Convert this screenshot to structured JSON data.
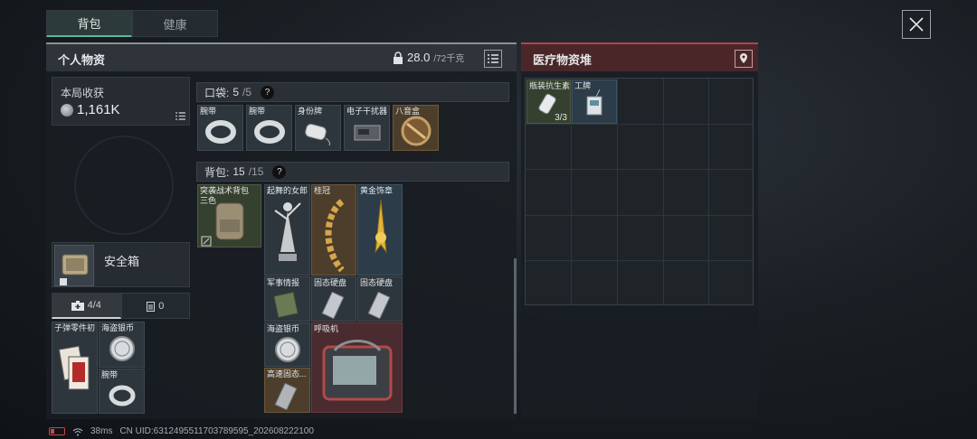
{
  "tabs": [
    {
      "label": "背包",
      "active": true
    },
    {
      "label": "健康",
      "active": false
    }
  ],
  "left_panel": {
    "title": "个人物资",
    "weight_current": "28.0",
    "weight_max": "/72千克"
  },
  "right_panel": {
    "title": "医疗物资堆"
  },
  "earnings": {
    "label": "本局收获",
    "value": "1,161K"
  },
  "safe": {
    "label": "安全箱"
  },
  "sub_tabs": [
    {
      "label": "4/4",
      "icon": "medkit-icon"
    },
    {
      "label": "0",
      "icon": "clipboard-icon"
    }
  ],
  "pocket": {
    "label": "口袋:",
    "count": "5",
    "capacity": "/5",
    "items": [
      "腕带",
      "腕带",
      "身份牌",
      "电子干扰器",
      "八音盒"
    ]
  },
  "backpack": {
    "label": "背包:",
    "count": "15",
    "capacity": "/15",
    "equipped": "突袭战术背包三色",
    "items": [
      "起舞的女郎",
      "桂冠",
      "黄金饰章",
      "军事情报",
      "固态硬盘",
      "固态硬盘",
      "海盗银币",
      "呼吸机",
      "高速固态..."
    ]
  },
  "mini_items": [
    "子弹零件初",
    "海盗银币",
    "腕带"
  ],
  "loot": {
    "items": [
      {
        "name": "瓶装抗生素",
        "qty": "3/3"
      },
      {
        "name": "工牌"
      }
    ]
  },
  "status_bar": {
    "ping": "38ms",
    "uid": "CN UID:6312495511703789595_202608222100"
  },
  "colors": {
    "accent_green": "#5fb89a",
    "loot_header": "#4a2629",
    "rare_red": "#4a2b2f",
    "rare_gold": "#4d3e2c"
  }
}
